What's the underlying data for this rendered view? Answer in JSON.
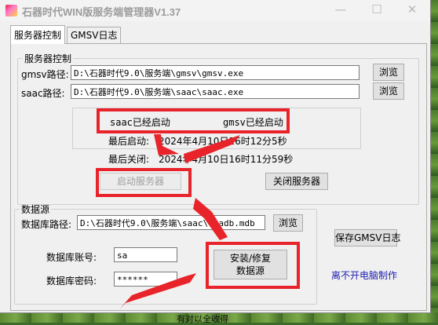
{
  "window": {
    "title": "石器时代WIN版服务端管理器V1.37",
    "minimize_glyph": "—",
    "maximize_glyph": "☐",
    "close_glyph": "✕"
  },
  "tabs": [
    {
      "label": "服务器控制",
      "active": true
    },
    {
      "label": "GMSV日志",
      "active": false
    }
  ],
  "server_control": {
    "legend": "服务器控制",
    "gmsv_label": "gmsv路径:",
    "gmsv_path": "D:\\石器时代9.0\\服务端\\gmsv\\gmsv.exe",
    "saac_label": "saac路径:",
    "saac_path": "D:\\石器时代9.0\\服务端\\saac\\saac.exe",
    "browse_label": "浏览",
    "saac_status": "saac已经启动",
    "gmsv_status": "gmsv已经启动",
    "last_start_label": "最后启动:",
    "last_start_value": "2024年4月10日16时12分5秒",
    "last_stop_label": "最后关闭:",
    "last_stop_value": "2024年4月10日16时11分59秒",
    "start_button": "启动服务器",
    "stop_button": "关闭服务器"
  },
  "data_source": {
    "legend": "数据源",
    "db_path_label": "数据库路径:",
    "db_path": "D:\\石器时代9.0\\服务端\\saac\\csadb.mdb",
    "browse_label": "浏览",
    "account_label": "数据库账号:",
    "account_value": "sa",
    "password_label": "数据库密码:",
    "password_value": "******",
    "install_button_line1": "安装/修复",
    "install_button_line2": "数据源"
  },
  "save_log_button": "保存GMSV日志",
  "footer_note": "离不开电脑制作",
  "background_text": "有对以全收得",
  "colors": {
    "annotation_red": "#e8232a",
    "footer_blue": "#2020b0"
  }
}
